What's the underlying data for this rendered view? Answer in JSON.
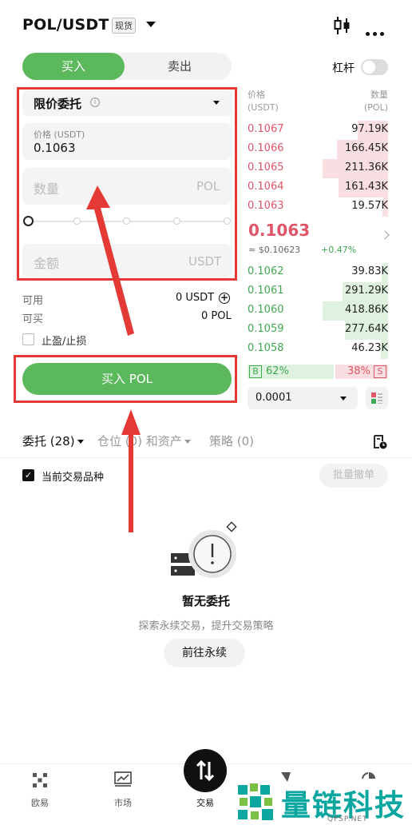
{
  "header": {
    "pair": "POL/USDT",
    "market_tag": "现货",
    "icons": [
      "candlestick-icon",
      "more-icon"
    ]
  },
  "trade": {
    "buy_tab": "买入",
    "sell_tab": "卖出",
    "leverage_label": "杠杆",
    "leverage_on": false,
    "order_type": "限价委托",
    "price_label": "价格 (USDT)",
    "price_value": "0.1063",
    "qty_placeholder": "数量",
    "qty_unit": "POL",
    "amount_placeholder": "金额",
    "amount_unit": "USDT",
    "available_label": "可用",
    "available_value": "0 USDT",
    "can_buy_label": "可买",
    "can_buy_value": "0 POL",
    "tpsl_label": "止盈/止损",
    "buy_button": "买入 POL"
  },
  "orderbook": {
    "price_header": "价格",
    "price_unit": "(USDT)",
    "qty_header": "数量",
    "qty_unit": "(POL)",
    "asks": [
      {
        "price": "0.1067",
        "qty": "97.19K",
        "depth": 0.46
      },
      {
        "price": "0.1066",
        "qty": "166.45K",
        "depth": 0.78
      },
      {
        "price": "0.1065",
        "qty": "211.36K",
        "depth": 1.0
      },
      {
        "price": "0.1064",
        "qty": "161.43K",
        "depth": 0.76
      },
      {
        "price": "0.1063",
        "qty": "19.57K",
        "depth": 0.09
      }
    ],
    "last_price": "0.1063",
    "last_price_sub": "≈ $0.10623",
    "last_change": "+0.47%",
    "bids": [
      {
        "price": "0.1062",
        "qty": "39.83K",
        "depth": 0.1
      },
      {
        "price": "0.1061",
        "qty": "291.29K",
        "depth": 0.7
      },
      {
        "price": "0.1060",
        "qty": "418.86K",
        "depth": 1.0
      },
      {
        "price": "0.1059",
        "qty": "277.64K",
        "depth": 0.66
      },
      {
        "price": "0.1058",
        "qty": "46.23K",
        "depth": 0.11
      }
    ],
    "buy_tag": "B",
    "buy_ratio": "62%",
    "sell_ratio": "38%",
    "sell_tag": "S",
    "precision": "0.0001"
  },
  "tabs": {
    "orders": "委托 (28)",
    "positions": "仓位 (0) 和资产",
    "strategies": "策略 (0)"
  },
  "filter": {
    "current_pair_label": "当前交易品种",
    "batch_cancel": "批量撤单"
  },
  "empty": {
    "title": "暂无委托",
    "subtitle": "探索永续交易，提升交易策略",
    "cta": "前往永续"
  },
  "nav": {
    "items": [
      "欧易",
      "市场",
      "交易"
    ]
  },
  "watermark": {
    "text": "量链科技",
    "sub": "QFSP.NET"
  },
  "colors": {
    "buy": "#5cb85c",
    "ask": "#e05567",
    "bid": "#3faa52",
    "annotation": "#e53935"
  }
}
